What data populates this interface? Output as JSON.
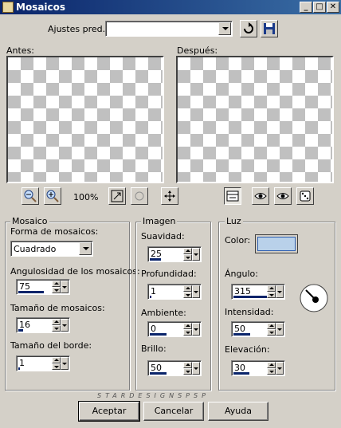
{
  "window": {
    "title": "Mosaicos",
    "minimize": "_",
    "maximize": "□",
    "close": "✕"
  },
  "presets": {
    "label": "Ajustes pred.:",
    "value": ""
  },
  "preview": {
    "before_label": "Antes:",
    "after_label": "Después:",
    "zoom": "100%"
  },
  "mosaic_group": {
    "legend": "Mosaico",
    "shape_label": "Forma de mosaicos:",
    "shape_value": "Cuadrado",
    "angularity_label": "Angulosidad de los mosaicos:",
    "angularity_value": "75",
    "size_label": "Tamaño de mosaicos:",
    "size_value": "16",
    "border_label": "Tamaño del borde:",
    "border_value": "1"
  },
  "image_group": {
    "legend": "Imagen",
    "smoothness_label": "Suavidad:",
    "smoothness_value": "25",
    "depth_label": "Profundidad:",
    "depth_value": "1",
    "ambient_label": "Ambiente:",
    "ambient_value": "0",
    "brightness_label": "Brillo:",
    "brightness_value": "50"
  },
  "light_group": {
    "legend": "Luz",
    "color_label": "Color:",
    "color_value": "#b9d1ea",
    "angle_label": "Ángulo:",
    "angle_value": "315",
    "intensity_label": "Intensidad:",
    "intensity_value": "50",
    "elevation_label": "Elevación:",
    "elevation_value": "30"
  },
  "watermark": "STARDESIGNSPSP",
  "buttons": {
    "accept": "Aceptar",
    "cancel": "Cancelar",
    "help": "Ayuda"
  }
}
